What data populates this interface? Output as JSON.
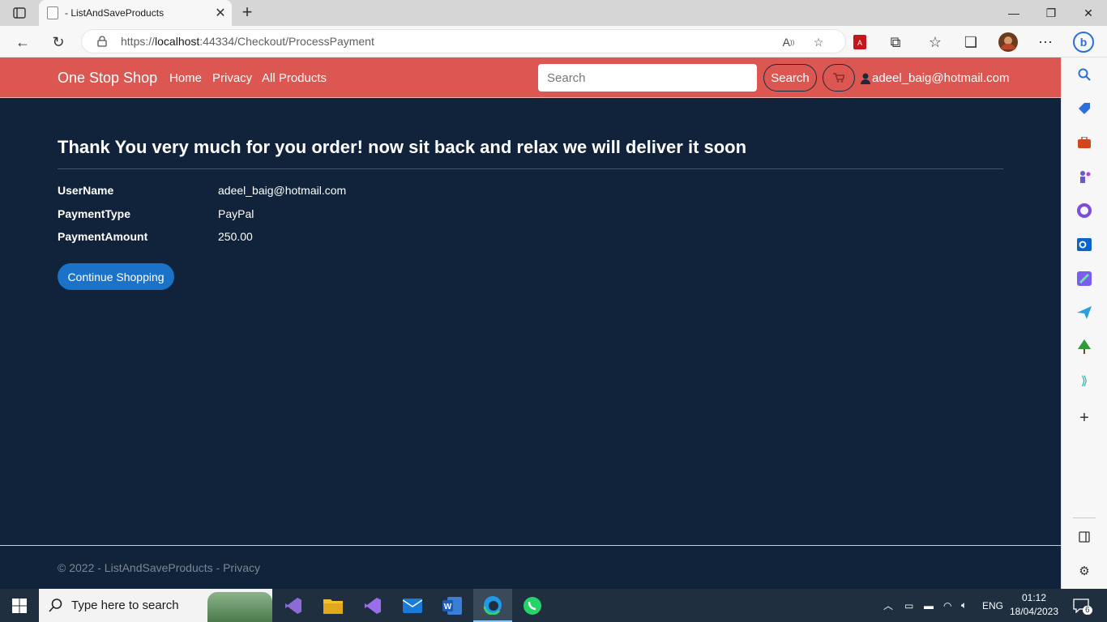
{
  "browser": {
    "tab_title": "- ListAndSaveProducts",
    "url_prefix": "https://",
    "url_host": "localhost",
    "url_path": ":44334/Checkout/ProcessPayment"
  },
  "navbar": {
    "brand": "One Stop Shop",
    "links": [
      "Home",
      "Privacy",
      "All Products"
    ],
    "search_placeholder": "Search",
    "search_button": "Search",
    "user": "adeel_baig@hotmail.com"
  },
  "main": {
    "heading": "Thank You very much for you order! now sit back and relax we will deliver it soon",
    "details": [
      {
        "label": "UserName",
        "value": "adeel_baig@hotmail.com"
      },
      {
        "label": "PaymentType",
        "value": "PayPal"
      },
      {
        "label": "PaymentAmount",
        "value": "250.00"
      }
    ],
    "continue_button": "Continue Shopping"
  },
  "footer": {
    "copyright": "© 2022 - ListAndSaveProducts - ",
    "privacy_link": "Privacy"
  },
  "taskbar": {
    "search_placeholder": "Type here to search",
    "language": "ENG",
    "time": "01:12",
    "date": "18/04/2023",
    "notification_count": "6"
  },
  "colors": {
    "navbar": "#dc5752",
    "page_background": "#10233a",
    "primary_button": "#1a73c9"
  }
}
